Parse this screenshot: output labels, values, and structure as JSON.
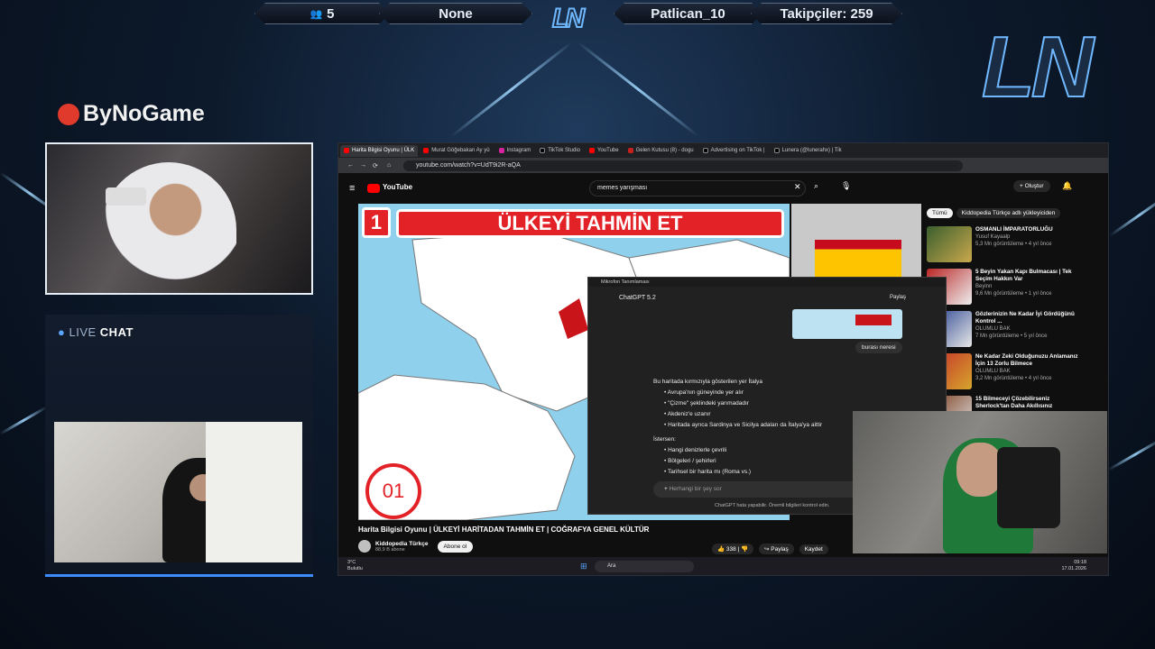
{
  "topbar": {
    "viewers": "5",
    "last_follower": "None",
    "top_supporter": "Patlican_10",
    "followers_label": "Takipçiler: 259",
    "logo_text": "LN"
  },
  "sponsor": {
    "name": "ByNoGame"
  },
  "chat": {
    "title_live": "LIVE",
    "title_chat": "CHAT"
  },
  "browser": {
    "tabs": [
      "Harita Bilgisi Oyunu | ÜLK",
      "Murat Göğebakan Ay yü",
      "Instagram",
      "TikTok Studio",
      "YouTube",
      "Gelen Kutusu (8) - dogu",
      "Advertising on TikTok |",
      "Lunera (@lunerahx) | Tik"
    ],
    "url": "youtube.com/watch?v=UdT9i2R-aQA"
  },
  "youtube": {
    "brand": "YouTube",
    "search_value": "memes yarışması",
    "create_label": "Oluştur"
  },
  "video": {
    "question_number": "1",
    "banner": "ÜLKEYİ TAHMİN ET",
    "timer": "01",
    "title": "Harita Bilgisi Oyunu | ÜLKEYİ HARİTADAN TAHMİN ET | COĞRAFYA GENEL KÜLTÜR",
    "channel": "Kiddopedia Türkçe",
    "subscribers": "88,9 B abone",
    "subscribe_label": "Abone ol",
    "likes": "338",
    "share_label": "Paylaş",
    "save_label": "Kaydet"
  },
  "sidebar": {
    "chips": [
      "Tümü",
      "Kiddopedia Türkçe adlı yükleyiciden"
    ],
    "videos": [
      {
        "title": "OSMANLI İMPARATORLUĞU",
        "channel": "Yusuf Kayaalp",
        "meta": "5,3 Mn görüntüleme • 4 yıl önce"
      },
      {
        "title": "5 Beyin Yakan Kapı Bulmacası | Tek Seçim Hakkın Var",
        "channel": "Beyinn",
        "meta": "9,6 Mn görüntüleme • 1 yıl önce"
      },
      {
        "title": "Gözlerinizin Ne Kadar İyi Gördüğünü Kontrol ...",
        "channel": "OLUMLU BAK",
        "meta": "7 Mn görüntüleme • 5 yıl önce"
      },
      {
        "title": "Ne Kadar Zeki Olduğunuzu Anlamanız İçin 13 Zorlu Bilmece",
        "channel": "OLUMLU BAK",
        "meta": "3,2 Mn görüntüleme • 4 yıl önce"
      },
      {
        "title": "15 Bilmeceyi Çözebilirseniz Sherlock'tan Daha Akıllısınız"
      }
    ]
  },
  "chatgpt": {
    "window_title": "Mikrofon Tanımlaması",
    "model": "ChatGPT 5.2",
    "share_label": "Paylaş",
    "user_message": "burası neresi",
    "answer_intro": "Bu haritada kırmızıyla gösterilen yer İtalya",
    "bullets": [
      "Avrupa'nın güneyinde yer alır",
      "\"Çizme\" şeklindeki yarımadadır",
      "Akdeniz'e uzanır",
      "Haritada ayrıca Sardinya ve Sicilya adaları da İtalya'ya aittir"
    ],
    "followup_intro": "İstersen:",
    "followups": [
      "Hangi denizlerle çevrili",
      "Bölgeleri / şehirleri",
      "Tarihsel bir harita mı (Roma vs.)"
    ],
    "input_placeholder": "Herhangi bir şey sor",
    "disclaimer": "ChatGPT hata yapabilir. Önemli bilgileri kontrol edin."
  },
  "taskbar": {
    "temperature": "3°C",
    "weather": "Bulutlu",
    "search_placeholder": "Ara",
    "time": "09:18",
    "date": "17.01.2026"
  }
}
